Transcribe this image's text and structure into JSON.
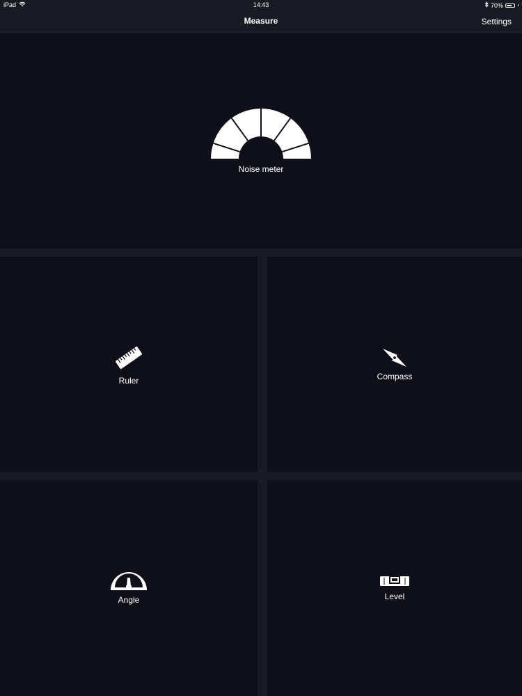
{
  "status_bar": {
    "device": "iPad",
    "time": "14:43",
    "battery": "70%",
    "battery_level": 0.7
  },
  "nav": {
    "title": "Measure",
    "settings_label": "Settings"
  },
  "tiles": {
    "noise_meter": {
      "label": "Noise meter",
      "icon": "noise-meter-icon"
    },
    "ruler": {
      "label": "Ruler",
      "icon": "ruler-icon"
    },
    "compass": {
      "label": "Compass",
      "icon": "compass-icon"
    },
    "angle": {
      "label": "Angle",
      "icon": "protractor-icon"
    },
    "level": {
      "label": "Level",
      "icon": "spirit-level-icon"
    }
  },
  "colors": {
    "background": "#171a22",
    "tile": "#0f0f1a",
    "text": "#ffffff"
  }
}
